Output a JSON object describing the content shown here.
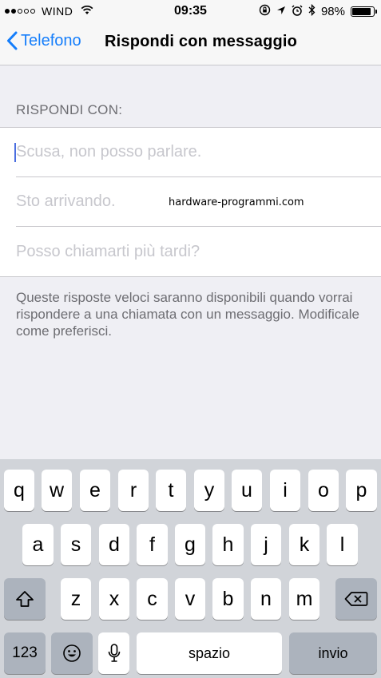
{
  "status_bar": {
    "carrier": "WIND",
    "signal_dots_filled": 2,
    "signal_dots_total": 5,
    "time": "09:35",
    "battery_percent": "98%",
    "battery_level": 0.98,
    "icons": [
      "wifi-icon",
      "orientation-lock-icon",
      "location-icon",
      "alarm-icon",
      "bluetooth-icon",
      "battery-icon"
    ]
  },
  "nav": {
    "back_label": "Telefono",
    "title": "Rispondi con messaggio",
    "accent_color": "#157efb"
  },
  "section": {
    "header": "RISPONDI CON:",
    "responses": [
      {
        "placeholder": "Scusa, non posso parlare.",
        "value": ""
      },
      {
        "placeholder": "Sto arrivando.",
        "value": ""
      },
      {
        "placeholder": "Posso chiamarti più tardi?",
        "value": ""
      }
    ],
    "footer": "Queste risposte veloci saranno disponibili quando vorrai rispondere a una chiamata con un messaggio. Modificale come preferisci."
  },
  "watermark": "hardware-programmi.com",
  "keyboard": {
    "row1": [
      "q",
      "w",
      "e",
      "r",
      "t",
      "y",
      "u",
      "i",
      "o",
      "p"
    ],
    "row2": [
      "a",
      "s",
      "d",
      "f",
      "g",
      "h",
      "j",
      "k",
      "l"
    ],
    "row3": [
      "z",
      "x",
      "c",
      "v",
      "b",
      "n",
      "m"
    ],
    "numbers_label": "123",
    "space_label": "spazio",
    "return_label": "invio"
  }
}
